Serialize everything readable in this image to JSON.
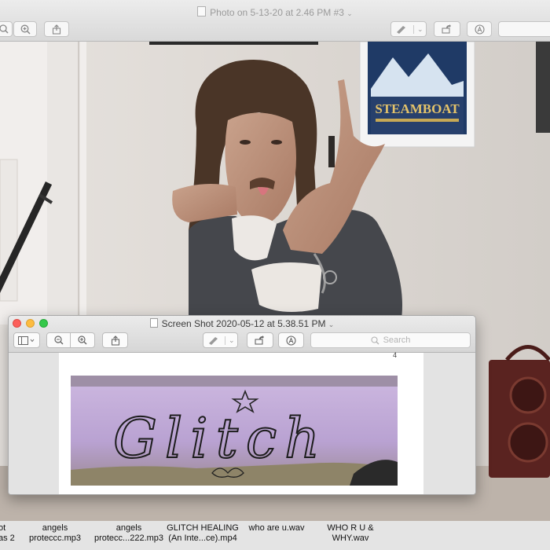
{
  "back_window": {
    "title": "Photo on 5-13-20 at 2.46 PM #3",
    "poster_text": "STEAMBOAT"
  },
  "front_window": {
    "title": "Screen Shot 2020-05-12 at 5.38.51 PM",
    "search_placeholder": "Search",
    "page_number": "4",
    "image_text": "Glitch"
  },
  "desktop_files": [
    {
      "line1": "ot",
      "line2": "as 2"
    },
    {
      "line1": "angels",
      "line2": "proteccc.mp3"
    },
    {
      "line1": "angels",
      "line2": "protecc...222.mp3"
    },
    {
      "line1": "GLITCH HEALING",
      "line2": "(An Inte...ce).mp4"
    },
    {
      "line1": "who are u.wav",
      "line2": ""
    },
    {
      "line1": "WHO R U &",
      "line2": "WHY.wav"
    }
  ],
  "colors": {
    "close": "#fc605c",
    "minimize": "#fdbc40",
    "zoom": "#34c84a",
    "foam": "#bfa8d8"
  }
}
